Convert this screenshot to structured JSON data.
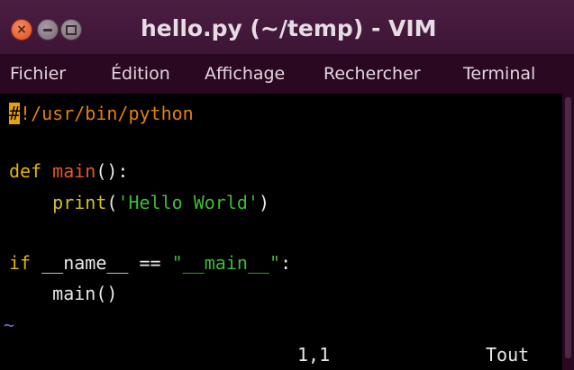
{
  "window": {
    "title": "hello.py (~/temp) - VIM",
    "buttons": {
      "close_glyph": "×"
    }
  },
  "menu": {
    "items": [
      "Fichier",
      "Édition",
      "Affichage",
      "Rechercher",
      "Terminal"
    ]
  },
  "editor": {
    "lines": {
      "l1_cursor": "#",
      "l1_rest": "!/usr/bin/python",
      "l3_kw": "def",
      "l3_fn": "main",
      "l3_rest": "():",
      "l4_indent": "    ",
      "l4_builtin": "print",
      "l4_open": "(",
      "l4_str": "'Hello World'",
      "l4_close": ")",
      "l6_kw": "if",
      "l6_rest": " __name__ == ",
      "l6_str": "\"__main__\"",
      "l6_colon": ":",
      "l7": "    main()",
      "l8_tilde": "~"
    },
    "status": {
      "position": "1,1",
      "scroll": "Tout"
    }
  },
  "colors": {
    "background": "#000000",
    "cursor": "#e8a20a",
    "keyword": "#e0b40c",
    "function": "#e45a1e",
    "string": "#3fba38",
    "tilde": "#6a6ad8",
    "titlebar": "#3d1436"
  }
}
